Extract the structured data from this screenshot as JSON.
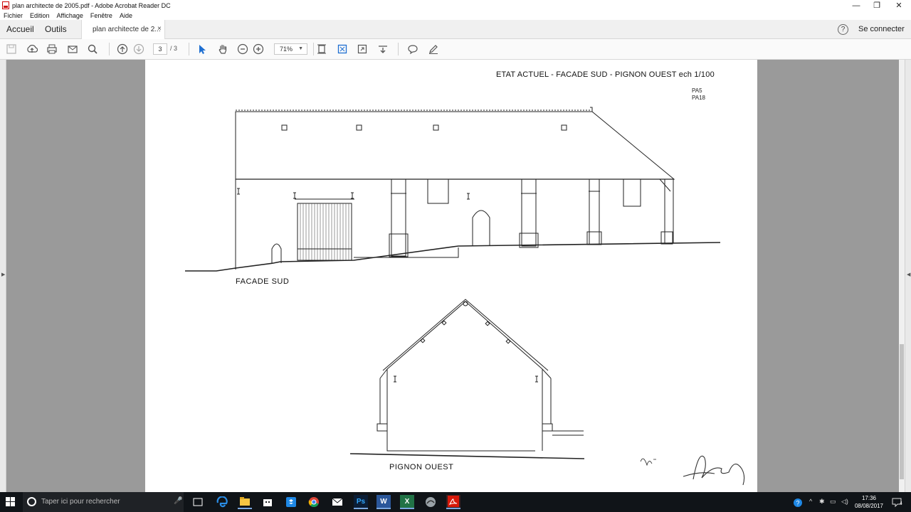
{
  "window": {
    "title": "plan architecte de 2005.pdf - Adobe Acrobat Reader DC",
    "controls": {
      "minimize": "—",
      "restore": "❐",
      "close": "✕"
    }
  },
  "menu": [
    "Fichier",
    "Edition",
    "Affichage",
    "Fenêtre",
    "Aide"
  ],
  "tabs": {
    "home": "Accueil",
    "tools": "Outils",
    "document": "plan architecte de 2...",
    "close": "×",
    "help": "?",
    "signin": "Se connecter"
  },
  "toolbar": {
    "page_current": "3",
    "page_total": "/ 3",
    "zoom": "71%",
    "icons": [
      "save-icon",
      "upload-icon",
      "print-icon",
      "email-icon",
      "search-icon",
      "prev-page-icon",
      "next-page-icon",
      "select-tool-icon",
      "hand-tool-icon",
      "zoom-out-icon",
      "zoom-in-icon",
      "fit-page-icon",
      "full-screen-icon",
      "rotate-icon",
      "scroll-mode-icon",
      "comment-icon",
      "sign-icon"
    ]
  },
  "document": {
    "title": "ETAT ACTUEL  - FACADE SUD - PIGNON OUEST  ech  1/100",
    "refs": [
      "PA5",
      "PA18"
    ],
    "caption_south": "FACADE   SUD",
    "caption_west": "PIGNON   OUEST"
  },
  "taskbar": {
    "search_placeholder": "Taper ici pour rechercher",
    "apps": [
      "task-view",
      "edge",
      "file-explorer",
      "store",
      "dropbox",
      "chrome",
      "mail",
      "photoshop",
      "word",
      "excel",
      "bird-app",
      "acrobat"
    ],
    "app_labels": {
      "photoshop": "Ps",
      "word": "W",
      "excel": "X"
    },
    "time": "17:36",
    "date": "08/08/2017",
    "notification_count": "4"
  },
  "colors": {
    "accent": "#1f6fd1",
    "acrobat_red": "#d7190a",
    "viewport_bg": "#9a9a9a",
    "taskbar_bg": "#101418"
  }
}
